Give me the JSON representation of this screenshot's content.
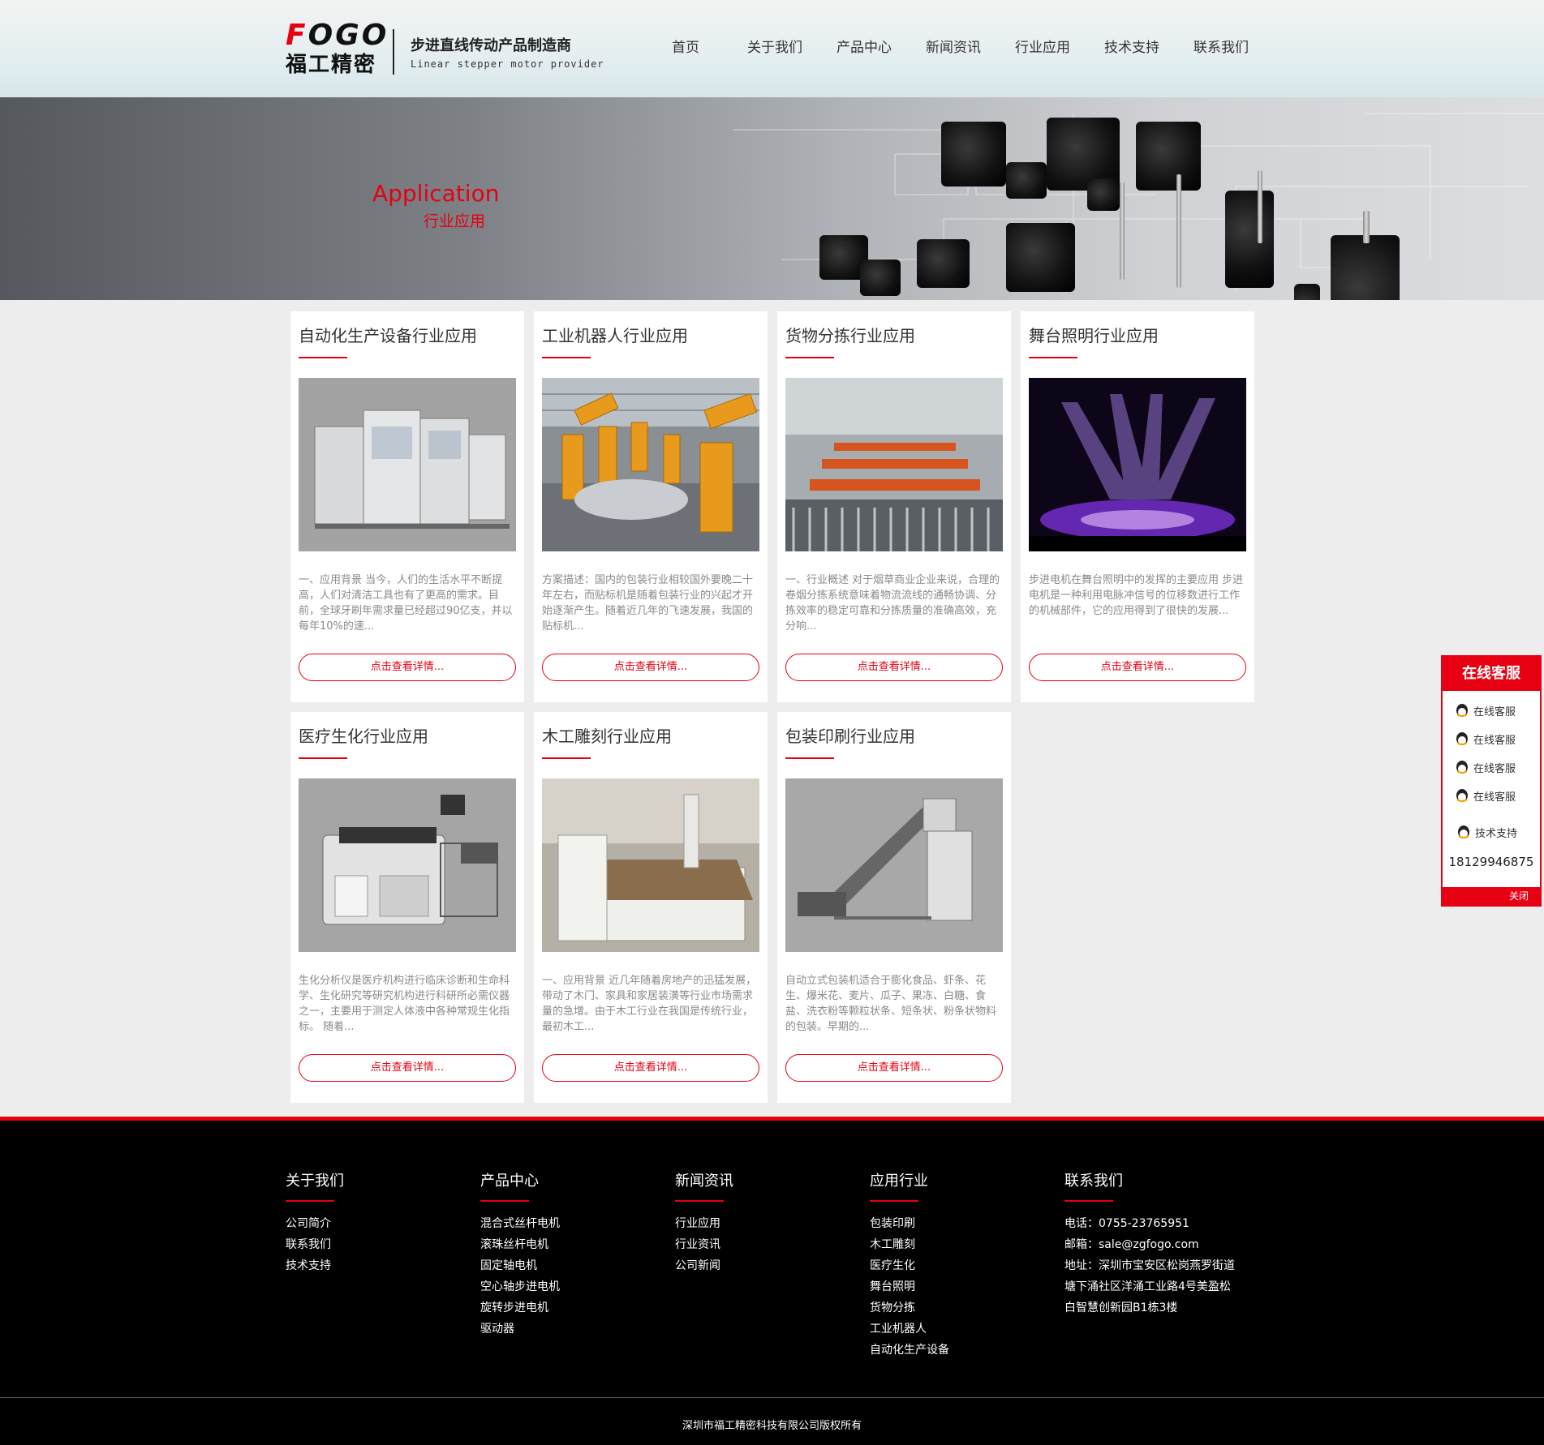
{
  "header": {
    "logo_en": "FOGO",
    "logo_cn": "福工精密",
    "tagline_cn": "步进直线传动产品制造商",
    "tagline_en": "Linear stepper motor provider",
    "nav": [
      "首页",
      "关于我们",
      "产品中心",
      "新闻资讯",
      "行业应用",
      "技术支持",
      "联系我们"
    ]
  },
  "banner": {
    "title": "Application",
    "subtitle": "行业应用"
  },
  "cards": [
    {
      "title": "自动化生产设备行业应用",
      "desc": "一、应用背景 当今，人们的生活水平不断提高，人们对清洁工具也有了更高的需求。目前，全球牙刷年需求量已经超过90亿支，并以每年10%的速...",
      "button": "点击查看详情..."
    },
    {
      "title": "工业机器人行业应用",
      "desc": "方案描述：国内的包装行业相较国外要晚二十年左右，而贴标机是随着包装行业的兴起才开始逐渐产生。随着近几年的飞速发展，我国的贴标机...",
      "button": "点击查看详情..."
    },
    {
      "title": "货物分拣行业应用",
      "desc": "一、行业概述 对于烟草商业企业来说，合理的卷烟分拣系统意味着物流流线的通畅协调、分拣效率的稳定可靠和分拣质量的准确高效，充分响...",
      "button": "点击查看详情..."
    },
    {
      "title": "舞台照明行业应用",
      "desc": "步进电机在舞台照明中的发挥的主要应用 步进电机是一种利用电脉冲信号的位移数进行工作的机械部件，它的应用得到了很快的发展...",
      "button": "点击查看详情..."
    },
    {
      "title": "医疗生化行业应用",
      "desc": "生化分析仪是医疗机构进行临床诊断和生命科学、生化研究等研究机构进行科研所必需仪器之一，主要用于测定人体液中各种常规生化指标。 随着...",
      "button": "点击查看详情..."
    },
    {
      "title": "木工雕刻行业应用",
      "desc": "一、应用背景 近几年随着房地产的迅猛发展，带动了木门、家具和家居装潢等行业市场需求量的急增。由于木工行业在我国是传统行业，最初木工...",
      "button": "点击查看详情..."
    },
    {
      "title": "包装印刷行业应用",
      "desc": "自动立式包装机适合于膨化食品、虾条、花生、爆米花、麦片、瓜子、果冻、白糖、食盐、洗衣粉等颗粒状条、短条状、粉条状物料的包装。早期的...",
      "button": "点击查看详情..."
    }
  ],
  "footer": {
    "about": {
      "title": "关于我们",
      "items": [
        "公司简介",
        "联系我们",
        "技术支持"
      ]
    },
    "products": {
      "title": "产品中心",
      "items": [
        "混合式丝杆电机",
        "滚珠丝杆电机",
        "固定轴电机",
        "空心轴步进电机",
        "旋转步进电机",
        "驱动器"
      ]
    },
    "news": {
      "title": "新闻资讯",
      "items": [
        "行业应用",
        "行业资讯",
        "公司新闻"
      ]
    },
    "industries": {
      "title": "应用行业",
      "items": [
        "包装印刷",
        "木工雕刻",
        "医疗生化",
        "舞台照明",
        "货物分拣",
        "工业机器人",
        "自动化生产设备"
      ]
    },
    "contact": {
      "title": "联系我们",
      "lines": [
        "电话：0755-23765951",
        "邮箱：sale@zgfogo.com",
        "地址：深圳市宝安区松岗燕罗街道",
        "塘下涌社区洋涌工业路4号美盈松",
        "白智慧创新园B1栋3楼"
      ]
    },
    "copyright": "深圳市福工精密科技有限公司版权所有"
  },
  "service": {
    "title": "在线客服",
    "items": [
      "在线客服",
      "在线客服",
      "在线客服",
      "在线客服",
      "技术支持"
    ],
    "phone": "18129946875",
    "close": "关闭"
  },
  "colors": {
    "accent": "#e60012",
    "footer_bg": "#000000",
    "page_bg": "#ededed"
  }
}
